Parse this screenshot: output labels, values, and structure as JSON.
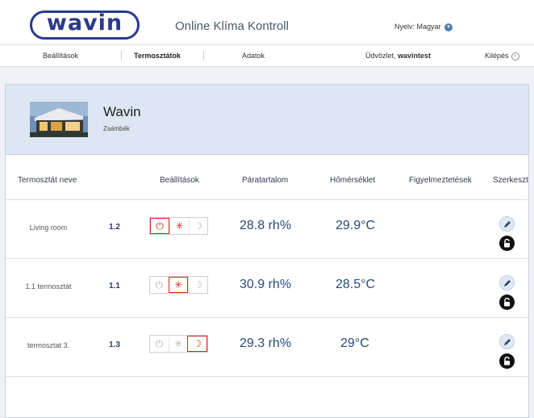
{
  "header": {
    "logo_text": "wavin",
    "app_title": "Online Klíma Kontroll",
    "language_label": "Nyelv: Magyar"
  },
  "nav": {
    "settings": "Beállítások",
    "thermostats": "Termosztátok",
    "data": "Adatok",
    "greeting_prefix": "Üdvözlet, ",
    "username": "wavintest",
    "logout": "Kilépés"
  },
  "house": {
    "name": "Wavin",
    "city": "Zsámbék"
  },
  "table": {
    "columns": [
      "Termosztát neve",
      "Beállítások",
      "Páratartalom",
      "Hőmérséklet",
      "Figyelmeztetések",
      "Szerkeszt"
    ],
    "rows": [
      {
        "name": "Living room",
        "number": "1.2",
        "humidity": "28.8 rh%",
        "temperature": "29.9°C",
        "active_mode": "power"
      },
      {
        "name": "1.1 termosztát",
        "number": "1.1",
        "humidity": "30.9 rh%",
        "temperature": "28.5°C",
        "active_mode": "comfort"
      },
      {
        "name": "termosztat 3.",
        "number": "1.3",
        "humidity": "29.3 rh%",
        "temperature": "29°C",
        "active_mode": "night"
      }
    ]
  },
  "icons": {
    "mode_buttons": [
      "power-icon",
      "sun-icon",
      "moon-icon"
    ],
    "edit": "pencil-icon",
    "lock": "lock-icon"
  },
  "colors": {
    "brand": "#2b3a8c",
    "active_mode": "#d7261e",
    "value_text": "#2a4a7a",
    "house_band": "#dde7f3"
  }
}
